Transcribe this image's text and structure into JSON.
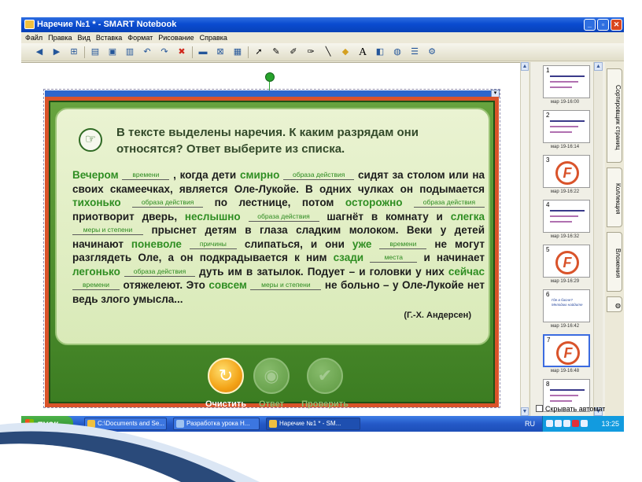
{
  "window": {
    "title": "Наречие №1 * - SMART Notebook",
    "controls": {
      "minimize": "_",
      "maximize": "▫",
      "close": "✕"
    }
  },
  "menu": [
    "Файл",
    "Правка",
    "Вид",
    "Вставка",
    "Формат",
    "Рисование",
    "Справка"
  ],
  "toolbar_icons": [
    "back-icon",
    "forward-icon",
    "add-page-icon",
    "open-icon",
    "save-icon",
    "paste-icon",
    "undo-icon",
    "redo-icon",
    "delete-icon",
    "screen-shade-icon",
    "full-screen-icon",
    "camera-icon",
    "select-icon",
    "pen-icon",
    "creative-pen-icon",
    "highlighter-icon",
    "line-icon",
    "eraser-icon",
    "text-icon",
    "fill-icon",
    "properties-icon",
    "toolbar-more-icon"
  ],
  "slide": {
    "question": "В тексте выделены наречия. К каким разрядам они относятся? Ответ выберите из списка.",
    "segments": [
      {
        "t": "adv",
        "v": "Вечером"
      },
      {
        "t": "ans",
        "v": "времени"
      },
      {
        "t": "txt",
        "v": ", когда дети "
      },
      {
        "t": "adv",
        "v": "смирно"
      },
      {
        "t": "ans",
        "v": "образа действия"
      },
      {
        "t": "txt",
        "v": " сидят за столом или на своих скамеечках, является Оле-Лукойе. В одних чулках он подымается "
      },
      {
        "t": "adv",
        "v": "тихонько"
      },
      {
        "t": "ans",
        "v": "образа действия"
      },
      {
        "t": "txt",
        "v": " по лестнице, потом "
      },
      {
        "t": "adv",
        "v": "осторожно"
      },
      {
        "t": "ans",
        "v": "образа действия"
      },
      {
        "t": "txt",
        "v": " приотворит дверь, "
      },
      {
        "t": "adv",
        "v": "неслышно"
      },
      {
        "t": "ans",
        "v": "образа действия"
      },
      {
        "t": "txt",
        "v": " шагнёт в комнату и "
      },
      {
        "t": "adv",
        "v": "слегка"
      },
      {
        "t": "ans",
        "v": "меры и степени"
      },
      {
        "t": "txt",
        "v": " прыснет детям в глаза сладким молоком. Веки у детей начинают "
      },
      {
        "t": "adv",
        "v": "поневоле"
      },
      {
        "t": "ans",
        "v": "причины"
      },
      {
        "t": "txt",
        "v": " слипаться, и они "
      },
      {
        "t": "adv",
        "v": "уже"
      },
      {
        "t": "ans",
        "v": "времени"
      },
      {
        "t": "txt",
        "v": " не могут разглядеть Оле, а он подкрадывается к ним "
      },
      {
        "t": "adv",
        "v": "сзади"
      },
      {
        "t": "ans",
        "v": "места"
      },
      {
        "t": "txt",
        "v": " и начинает "
      },
      {
        "t": "adv",
        "v": "легонько"
      },
      {
        "t": "ans",
        "v": "образа действия"
      },
      {
        "t": "txt",
        "v": " дуть им в затылок. Подует – и головки у них "
      },
      {
        "t": "adv",
        "v": "сейчас"
      },
      {
        "t": "ans",
        "v": "времени"
      },
      {
        "t": "txt",
        "v": " отяжелеют. Это "
      },
      {
        "t": "adv",
        "v": "совсем"
      },
      {
        "t": "ans",
        "v": "меры и степени"
      },
      {
        "t": "txt",
        "v": " не больно – у Оле-Лукойе нет ведь злого умысла..."
      }
    ],
    "author": "(Г.-Х. Андерсен)",
    "buttons": {
      "clear": "Очистить",
      "answer": "Ответ",
      "check": "Проверить"
    }
  },
  "sorter": {
    "pages": [
      {
        "num": "1",
        "date": "мар 19-16:00",
        "kind": "lines"
      },
      {
        "num": "2",
        "date": "мар 19-16:14",
        "kind": "lines"
      },
      {
        "num": "3",
        "date": "мар 19-16:22",
        "kind": "logo"
      },
      {
        "num": "4",
        "date": "мар 19-16:32",
        "kind": "lines"
      },
      {
        "num": "5",
        "date": "мар 19-16:29",
        "kind": "logo"
      },
      {
        "num": "6",
        "date": "мар 19-16:42",
        "kind": "text",
        "text": "Где в басне? Мелодию найдите"
      },
      {
        "num": "7",
        "date": "мар 19-16:48",
        "kind": "logo"
      },
      {
        "num": "8",
        "date": "",
        "kind": "lines"
      }
    ],
    "autohide_label": "Скрывать автомат"
  },
  "sidetabs": [
    "Сортировщик страниц",
    "Коллекция",
    "Вложения"
  ],
  "taskbar": {
    "start": "пуск",
    "tasks": [
      "C:\\Documents and Se...",
      "Разработка урока Н...",
      "Наречие №1 * - SM..."
    ],
    "lang": "RU",
    "clock": "13:25"
  },
  "colors": {
    "accent": "#2f8e22",
    "frame": "#d9532a",
    "titlebar": "#0a4bd0"
  }
}
